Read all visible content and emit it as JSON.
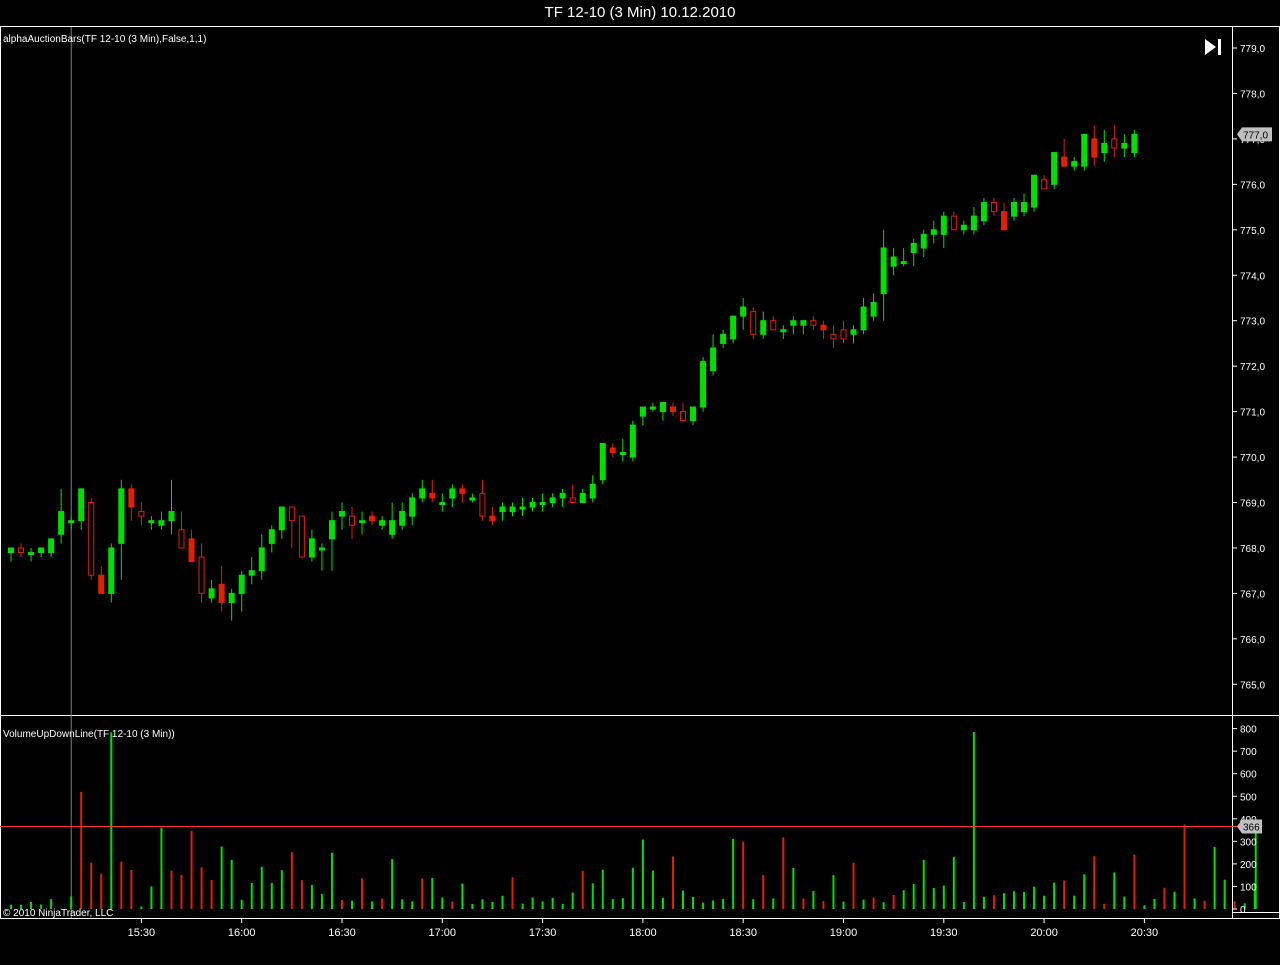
{
  "window": {
    "title": "TF 12-10 (3 Min)  10.12.2010"
  },
  "price_panel": {
    "indicator_label": "alphaAuctionBars(TF 12-10 (3 Min),False,1,1)",
    "last_price_tag": "777,0",
    "y_ticks": [
      "779,0",
      "778,0",
      "777,0",
      "776,0",
      "775,0",
      "774,0",
      "773,0",
      "772,0",
      "771,0",
      "770,0",
      "769,0",
      "768,0",
      "767,0",
      "766,0",
      "765,0"
    ]
  },
  "volume_panel": {
    "indicator_label": "VolumeUpDownLine(TF 12-10 (3 Min))",
    "last_volume_tag": "366",
    "y_ticks": [
      "800",
      "700",
      "600",
      "500",
      "400",
      "300",
      "200",
      "100",
      "0"
    ]
  },
  "x_axis": {
    "ticks": [
      "15:30",
      "16:00",
      "16:30",
      "17:00",
      "17:30",
      "18:00",
      "18:30",
      "19:00",
      "19:30",
      "20:00",
      "20:30"
    ]
  },
  "copyright": "© 2010 NinjaTrader, LLC",
  "colors": {
    "up": "#00e000",
    "down": "#e02000",
    "bg": "#000000",
    "grid_axis": "#ffffff",
    "level_line": "#ff3b1e",
    "tag_bg": "#bfbfbf"
  },
  "chart_data": [
    {
      "type": "candlestick",
      "title": "TF 12-10 (3 Min)  10.12.2010",
      "ylim": [
        764.5,
        779.2
      ],
      "time_start": "14:51",
      "time_end": "20:30",
      "interval_minutes": 3,
      "candles": [
        [
          767.9,
          768.0,
          767.7,
          768.0
        ],
        [
          768.0,
          768.1,
          767.8,
          767.9
        ],
        [
          767.9,
          768.0,
          767.7,
          767.9
        ],
        [
          767.9,
          768.0,
          767.8,
          768.0
        ],
        [
          767.9,
          768.2,
          767.8,
          768.2
        ],
        [
          768.3,
          769.3,
          768.1,
          768.8
        ],
        [
          768.6,
          768.7,
          768.4,
          768.6
        ],
        [
          768.6,
          769.3,
          768.4,
          769.3
        ],
        [
          769.0,
          769.1,
          767.3,
          767.4
        ],
        [
          767.4,
          767.6,
          767.0,
          767.0
        ],
        [
          767.0,
          768.1,
          766.8,
          768.0
        ],
        [
          768.1,
          769.5,
          767.3,
          769.3
        ],
        [
          769.3,
          769.4,
          768.6,
          768.9
        ],
        [
          768.8,
          769.0,
          768.5,
          768.7
        ],
        [
          768.6,
          768.7,
          768.4,
          768.6
        ],
        [
          768.5,
          768.8,
          768.4,
          768.6
        ],
        [
          768.6,
          769.5,
          768.3,
          768.8
        ],
        [
          768.4,
          768.8,
          768.1,
          768.0
        ],
        [
          768.2,
          768.4,
          767.8,
          767.7
        ],
        [
          767.8,
          768.1,
          766.8,
          767.0
        ],
        [
          766.9,
          767.3,
          766.8,
          767.1
        ],
        [
          767.2,
          767.6,
          766.6,
          766.8
        ],
        [
          766.8,
          767.1,
          766.4,
          767.0
        ],
        [
          767.0,
          767.5,
          766.6,
          767.4
        ],
        [
          767.4,
          767.8,
          767.2,
          767.5
        ],
        [
          767.5,
          768.3,
          767.3,
          768.0
        ],
        [
          768.1,
          768.5,
          767.9,
          768.4
        ],
        [
          768.4,
          768.9,
          768.2,
          768.9
        ],
        [
          768.9,
          768.7,
          768.0,
          768.6
        ],
        [
          768.7,
          768.4,
          767.9,
          767.8
        ],
        [
          767.8,
          768.4,
          767.7,
          768.2
        ],
        [
          768.0,
          768.1,
          767.5,
          768.0
        ],
        [
          768.2,
          768.8,
          767.5,
          768.6
        ],
        [
          768.7,
          769.0,
          768.4,
          768.8
        ],
        [
          768.7,
          768.9,
          768.2,
          768.5
        ],
        [
          768.6,
          768.8,
          768.3,
          768.6
        ],
        [
          768.7,
          768.8,
          768.5,
          768.6
        ],
        [
          768.5,
          768.7,
          768.4,
          768.6
        ],
        [
          768.3,
          769.0,
          768.2,
          768.6
        ],
        [
          768.5,
          769.0,
          768.4,
          768.8
        ],
        [
          768.7,
          769.2,
          768.5,
          769.1
        ],
        [
          769.1,
          769.5,
          769.0,
          769.3
        ],
        [
          769.2,
          769.5,
          769.0,
          769.1
        ],
        [
          769.0,
          769.2,
          768.8,
          769.0
        ],
        [
          769.1,
          769.4,
          768.9,
          769.3
        ],
        [
          769.3,
          769.4,
          769.0,
          769.2
        ],
        [
          769.1,
          769.2,
          769.0,
          769.1
        ],
        [
          769.2,
          769.5,
          768.6,
          768.7
        ],
        [
          768.7,
          768.9,
          768.5,
          768.6
        ],
        [
          768.8,
          769.0,
          768.6,
          768.9
        ],
        [
          768.8,
          769.0,
          768.7,
          768.9
        ],
        [
          768.9,
          769.1,
          768.7,
          768.9
        ],
        [
          768.9,
          769.1,
          768.8,
          769.0
        ],
        [
          769.0,
          769.2,
          768.8,
          769.0
        ],
        [
          769.0,
          769.2,
          768.9,
          769.1
        ],
        [
          769.1,
          769.3,
          768.9,
          769.2
        ],
        [
          769.1,
          769.4,
          769.0,
          769.0
        ],
        [
          769.0,
          769.3,
          769.0,
          769.2
        ],
        [
          769.1,
          769.6,
          769.0,
          769.4
        ],
        [
          769.5,
          770.3,
          769.4,
          770.3
        ],
        [
          770.2,
          770.3,
          770.0,
          770.1
        ],
        [
          770.1,
          770.4,
          769.9,
          770.1
        ],
        [
          770.0,
          770.8,
          769.9,
          770.7
        ],
        [
          770.9,
          771.1,
          770.7,
          771.1
        ],
        [
          771.1,
          771.2,
          771.0,
          771.1
        ],
        [
          771.0,
          771.2,
          770.8,
          771.2
        ],
        [
          771.1,
          771.2,
          770.9,
          771.0
        ],
        [
          771.0,
          771.2,
          770.9,
          770.8
        ],
        [
          770.8,
          771.0,
          770.7,
          771.1
        ],
        [
          771.1,
          772.2,
          771.0,
          772.1
        ],
        [
          771.9,
          772.7,
          771.8,
          772.4
        ],
        [
          772.5,
          772.8,
          772.4,
          772.7
        ],
        [
          772.6,
          773.1,
          772.5,
          773.1
        ],
        [
          773.1,
          773.5,
          772.8,
          773.3
        ],
        [
          773.2,
          773.3,
          772.6,
          772.7
        ],
        [
          772.7,
          773.2,
          772.6,
          773.0
        ],
        [
          773.0,
          773.1,
          772.8,
          772.8
        ],
        [
          772.8,
          772.9,
          772.6,
          772.8
        ],
        [
          772.9,
          773.1,
          772.7,
          773.0
        ],
        [
          772.9,
          773.0,
          772.7,
          773.0
        ],
        [
          773.0,
          773.1,
          772.8,
          772.9
        ],
        [
          772.9,
          773.0,
          772.6,
          772.8
        ],
        [
          772.7,
          772.9,
          772.4,
          772.6
        ],
        [
          772.8,
          773.0,
          772.5,
          772.6
        ],
        [
          772.7,
          772.9,
          772.5,
          772.8
        ],
        [
          772.8,
          773.5,
          772.7,
          773.3
        ],
        [
          773.1,
          773.6,
          773.0,
          773.4
        ],
        [
          773.6,
          775.0,
          773.0,
          774.6
        ],
        [
          774.2,
          774.6,
          774.0,
          774.4
        ],
        [
          774.3,
          774.6,
          774.2,
          774.3
        ],
        [
          774.5,
          774.8,
          774.2,
          774.7
        ],
        [
          774.6,
          775.0,
          774.4,
          774.9
        ],
        [
          774.9,
          775.2,
          774.7,
          775.0
        ],
        [
          774.9,
          775.4,
          774.6,
          775.3
        ],
        [
          775.3,
          775.4,
          775.0,
          775.0
        ],
        [
          775.0,
          775.2,
          774.9,
          775.1
        ],
        [
          775.0,
          775.5,
          774.9,
          775.3
        ],
        [
          775.2,
          775.7,
          775.1,
          775.6
        ],
        [
          775.6,
          775.7,
          775.3,
          775.4
        ],
        [
          775.4,
          775.6,
          775.2,
          775.0
        ],
        [
          775.3,
          775.7,
          775.2,
          775.6
        ],
        [
          775.4,
          775.8,
          775.3,
          775.6
        ],
        [
          775.5,
          776.2,
          775.4,
          776.2
        ],
        [
          776.1,
          776.2,
          775.9,
          775.9
        ],
        [
          776.0,
          776.7,
          775.9,
          776.7
        ],
        [
          776.6,
          777.0,
          776.4,
          776.4
        ],
        [
          776.4,
          776.6,
          776.3,
          776.5
        ],
        [
          776.4,
          777.1,
          776.3,
          777.1
        ],
        [
          777.0,
          777.3,
          776.4,
          776.6
        ],
        [
          776.7,
          777.2,
          776.5,
          776.9
        ],
        [
          777.0,
          777.3,
          776.6,
          776.8
        ],
        [
          776.8,
          777.1,
          776.6,
          776.9
        ],
        [
          776.7,
          777.2,
          776.6,
          777.1
        ]
      ]
    },
    {
      "type": "bar",
      "title": "VolumeUpDownLine(TF 12-10 (3 Min))",
      "ylim": [
        0,
        830
      ],
      "level_line": 366,
      "values": [
        19,
        19,
        31,
        20,
        44,
        2,
        56,
        519,
        205,
        157,
        784,
        210,
        173,
        11,
        100,
        361,
        170,
        151,
        346,
        185,
        129,
        277,
        218,
        41,
        115,
        187,
        116,
        172,
        253,
        128,
        106,
        66,
        249,
        40,
        37,
        136,
        34,
        46,
        221,
        43,
        34,
        135,
        137,
        51,
        33,
        113,
        22,
        43,
        31,
        59,
        140,
        24,
        51,
        34,
        50,
        23,
        73,
        169,
        114,
        174,
        44,
        48,
        183,
        308,
        170,
        50,
        233,
        81,
        54,
        28,
        38,
        45,
        311,
        298,
        43,
        151,
        47,
        318,
        182,
        47,
        80,
        35,
        150,
        33,
        205,
        42,
        50,
        30,
        62,
        83,
        111,
        218,
        93,
        104,
        230,
        31,
        785,
        54,
        61,
        70,
        78,
        75,
        99,
        59,
        117,
        126,
        59,
        154,
        234,
        22,
        162,
        55,
        241,
        16,
        45,
        94,
        77,
        375,
        47,
        37,
        275,
        130,
        34,
        25,
        114
      ],
      "up": [
        1,
        1,
        1,
        1,
        1,
        1,
        1,
        0,
        0,
        0,
        1,
        0,
        0,
        1,
        1,
        1,
        0,
        0,
        0,
        0,
        0,
        1,
        1,
        1,
        1,
        1,
        1,
        1,
        0,
        0,
        1,
        1,
        1,
        0,
        1,
        0,
        1,
        0,
        1,
        1,
        1,
        0,
        1,
        1,
        0,
        1,
        1,
        1,
        1,
        1,
        0,
        1,
        1,
        1,
        1,
        1,
        1,
        0,
        1,
        1,
        1,
        1,
        1,
        1,
        1,
        1,
        0,
        1,
        1,
        1,
        1,
        1,
        1,
        0,
        1,
        0,
        1,
        0,
        1,
        0,
        1,
        0,
        1,
        1,
        0,
        1,
        0,
        1,
        0,
        1,
        1,
        1,
        1,
        1,
        1,
        1,
        1,
        1,
        0,
        1,
        1,
        1,
        1,
        1,
        1,
        0,
        1,
        1,
        0,
        0,
        1,
        1,
        0,
        1,
        1,
        0,
        1,
        0,
        1,
        0,
        1,
        1,
        0,
        1,
        1,
        1
      ]
    }
  ]
}
